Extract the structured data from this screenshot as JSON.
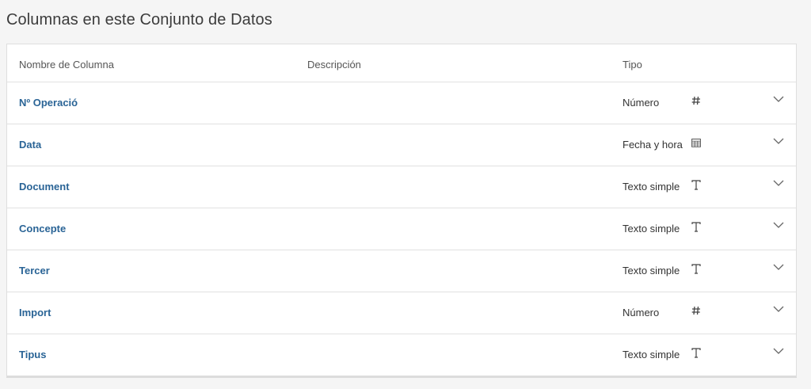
{
  "section": {
    "title": "Columnas en este Conjunto de Datos"
  },
  "table": {
    "headers": {
      "name": "Nombre de Columna",
      "description": "Descripción",
      "type": "Tipo"
    },
    "rows": [
      {
        "name": "Nº Operació",
        "description": "",
        "type": "Número",
        "icon": "hash-icon"
      },
      {
        "name": "Data",
        "description": "",
        "type": "Fecha y hora",
        "icon": "calendar-icon"
      },
      {
        "name": "Document",
        "description": "",
        "type": "Texto simple",
        "icon": "text-t-icon"
      },
      {
        "name": "Concepte",
        "description": "",
        "type": "Texto simple",
        "icon": "text-t-icon"
      },
      {
        "name": "Tercer",
        "description": "",
        "type": "Texto simple",
        "icon": "text-t-icon"
      },
      {
        "name": "Import",
        "description": "",
        "type": "Número",
        "icon": "hash-icon"
      },
      {
        "name": "Tipus",
        "description": "",
        "type": "Texto simple",
        "icon": "text-t-icon"
      }
    ]
  },
  "colors": {
    "link": "#2a6496",
    "background": "#f5f5f5",
    "border": "#e1e1e1"
  }
}
